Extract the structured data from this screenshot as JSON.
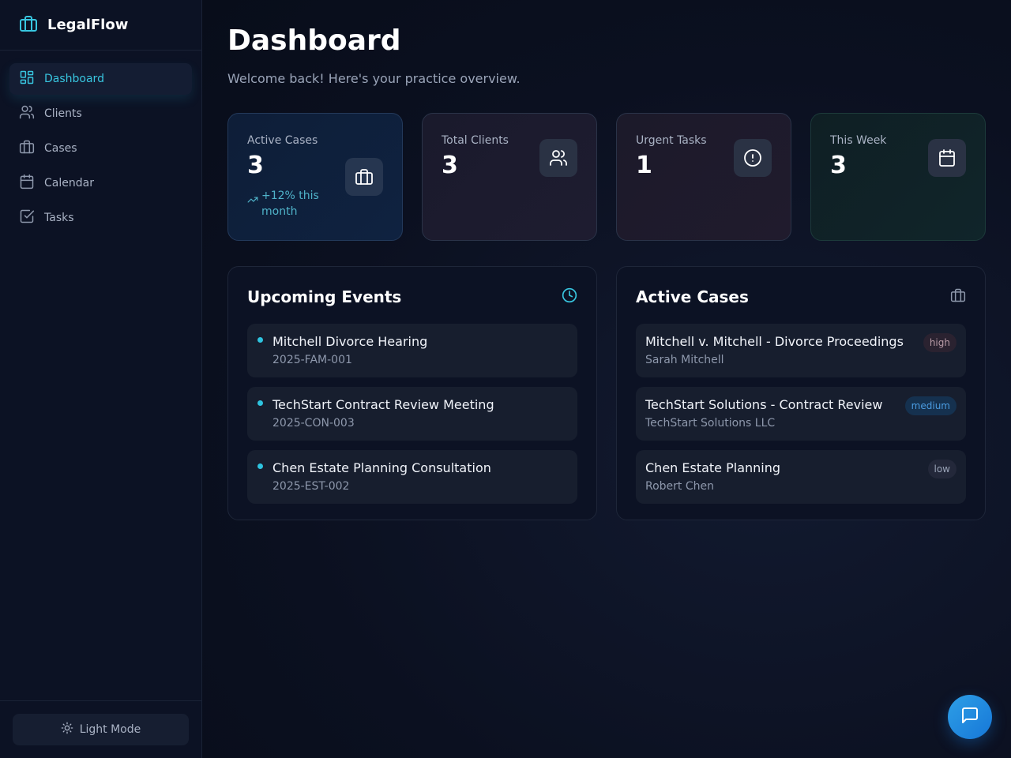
{
  "brand": {
    "name": "LegalFlow",
    "icon": "briefcase-icon"
  },
  "nav": {
    "items": [
      {
        "label": "Dashboard",
        "icon": "dashboard-icon",
        "active": true
      },
      {
        "label": "Clients",
        "icon": "users-icon"
      },
      {
        "label": "Cases",
        "icon": "briefcase-icon"
      },
      {
        "label": "Calendar",
        "icon": "calendar-icon"
      },
      {
        "label": "Tasks",
        "icon": "checkbox-icon"
      }
    ]
  },
  "theme_toggle": {
    "label": "Light Mode",
    "icon": "sun-icon"
  },
  "header": {
    "title": "Dashboard",
    "subtitle": "Welcome back! Here's your practice overview."
  },
  "stats": [
    {
      "label": "Active Cases",
      "value": "3",
      "trend": "+12% this month",
      "icon": "briefcase-icon"
    },
    {
      "label": "Total Clients",
      "value": "3",
      "icon": "users-icon"
    },
    {
      "label": "Urgent Tasks",
      "value": "1",
      "icon": "alert-circle-icon"
    },
    {
      "label": "This Week",
      "value": "3",
      "icon": "calendar-icon"
    }
  ],
  "events_panel": {
    "title": "Upcoming Events",
    "icon": "clock-icon",
    "items": [
      {
        "title": "Mitchell Divorce Hearing",
        "code": "2025-FAM-001"
      },
      {
        "title": "TechStart Contract Review Meeting",
        "code": "2025-CON-003"
      },
      {
        "title": "Chen Estate Planning Consultation",
        "code": "2025-EST-002"
      }
    ]
  },
  "cases_panel": {
    "title": "Active Cases",
    "icon": "briefcase-icon",
    "items": [
      {
        "title": "Mitchell v. Mitchell - Divorce Proceedings",
        "client": "Sarah Mitchell",
        "priority": "high"
      },
      {
        "title": "TechStart Solutions - Contract Review",
        "client": "TechStart Solutions LLC",
        "priority": "medium"
      },
      {
        "title": "Chen Estate Planning",
        "client": "Robert Chen",
        "priority": "low"
      }
    ]
  },
  "chat_button": {
    "icon": "chat-bubble-icon"
  },
  "colors": {
    "accent": "#38c6e0",
    "background": "#0b1020",
    "priority_high": "#b89aa6",
    "priority_medium": "#4a9be0",
    "priority_low": "#9aa4b8",
    "fab": "#1677d8"
  }
}
